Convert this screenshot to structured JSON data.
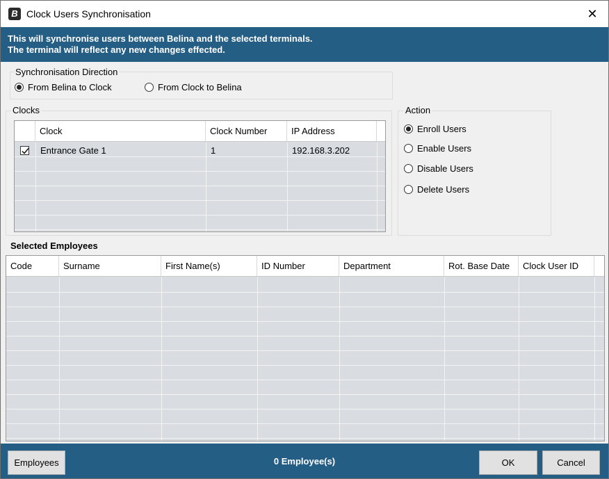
{
  "window": {
    "title": "Clock Users Synchronisation",
    "close_glyph": "✕"
  },
  "banner": {
    "line1": "This will synchronise users between Belina and the selected terminals.",
    "line2": "The terminal will reflect any new changes effected."
  },
  "direction": {
    "label": "Synchronisation Direction",
    "options": [
      "From Belina to Clock",
      "From Clock to Belina"
    ],
    "selected": "From Belina to Clock"
  },
  "clocks": {
    "label": "Clocks",
    "columns": [
      "Clock",
      "Clock Number",
      "IP Address"
    ],
    "rows": [
      {
        "checked": true,
        "clock": "Entrance Gate 1",
        "number": "1",
        "ip": "192.168.3.202"
      }
    ]
  },
  "action": {
    "label": "Action",
    "options": [
      "Enroll Users",
      "Enable Users",
      "Disable Users",
      "Delete Users"
    ],
    "selected": "Enroll Users"
  },
  "employees": {
    "label": "Selected Employees",
    "columns": [
      "Code",
      "Surname",
      "First Name(s)",
      "ID Number",
      "Department",
      "Rot. Base Date",
      "Clock User ID"
    ]
  },
  "footer": {
    "employees_button": "Employees",
    "count_text": "0 Employee(s)",
    "ok_button": "OK",
    "cancel_button": "Cancel"
  },
  "colors": {
    "accent": "#255e84",
    "grid_bg": "#d9dde2",
    "dialog_bg": "#f0f0f0"
  }
}
